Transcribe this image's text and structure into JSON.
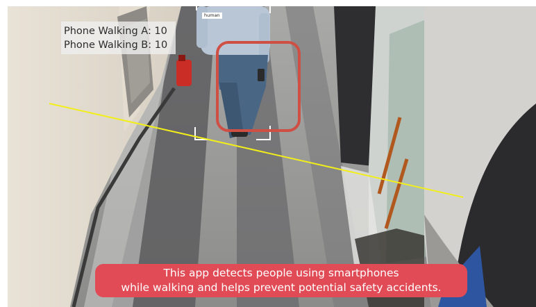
{
  "overlay": {
    "counters": [
      {
        "label": "Phone Walking A",
        "value": "10",
        "text": "Phone Walking A: 10"
      },
      {
        "label": "Phone Walking B",
        "value": "10",
        "text": "Phone Walking B: 10"
      }
    ],
    "detection_label": "human"
  },
  "caption": {
    "line1": "This app detects people using smartphones",
    "line2": "while walking and helps prevent potential safety accidents."
  },
  "colors": {
    "counting_line": "#f2ee1a",
    "phone_highlight": "#cf4f45",
    "caption_background": "#e14b56",
    "caption_text": "#ffffff"
  }
}
